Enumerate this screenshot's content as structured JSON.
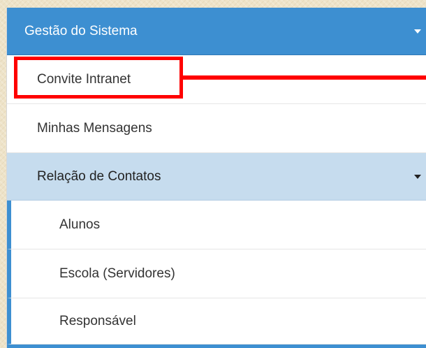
{
  "menu": {
    "header": {
      "label": "Gestão do Sistema",
      "expanded": true
    },
    "items": [
      {
        "label": "Convite Intranet",
        "highlighted": true
      },
      {
        "label": "Minhas Mensagens"
      },
      {
        "label": "Relação de Contatos",
        "expanded": true,
        "children": [
          {
            "label": "Alunos"
          },
          {
            "label": "Escola (Servidores)"
          },
          {
            "label": "Responsável"
          }
        ]
      }
    ]
  },
  "colors": {
    "header_bg": "#3d8fd1",
    "active_row_bg": "#c6dcee",
    "highlight": "#ff0000",
    "page_bg": "#eee3c8"
  },
  "icons": {
    "header_toggle": "caret-down-icon",
    "submenu_toggle": "caret-down-icon"
  }
}
